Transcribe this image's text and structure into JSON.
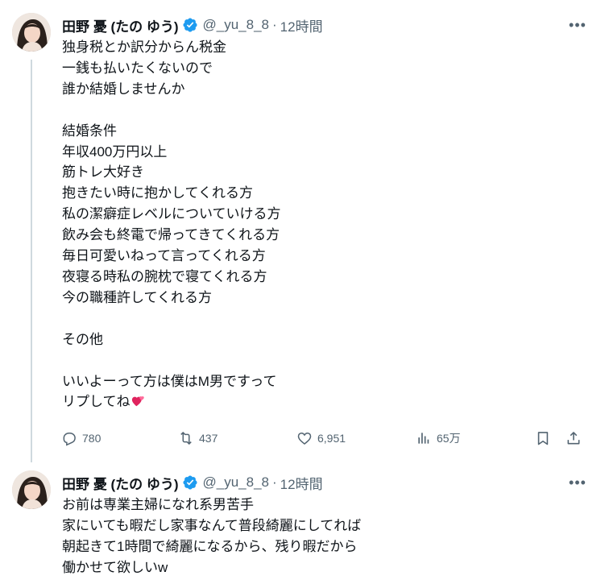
{
  "posts": [
    {
      "display_name": "田野 憂 (たの ゆう)",
      "handle": "@_yu_8_8",
      "separator": "·",
      "time": "12時間",
      "more_label": "•••",
      "text": "独身税とか訳分からん税金\n一銭も払いたくないので\n誰か結婚しませんか\n\n結婚条件\n年収400万円以上\n筋トレ大好き\n抱きたい時に抱かしてくれる方\n私の潔癖症レベルについていける方\n飲み会も終電で帰ってきてくれる方\n毎日可愛いねって言ってくれる方\n夜寝る時私の腕枕で寝てくれる方\n今の職種許してくれる方\n\nその他\n\nいいよーって方は僕はM男ですって\nリプしてね",
      "emoji_icon": "two-hearts",
      "stats": {
        "replies": "780",
        "reposts": "437",
        "likes": "6,951",
        "views": "65万"
      }
    },
    {
      "display_name": "田野 憂 (たの ゆう)",
      "handle": "@_yu_8_8",
      "separator": "·",
      "time": "12時間",
      "more_label": "•••",
      "text": "お前は専業主婦になれ系男苦手\n家にいても暇だし家事なんて普段綺麗にしてれば\n朝起きて1時間で綺麗になるから、残り暇だから\n働かせて欲しいw"
    }
  ],
  "colors": {
    "verified": "#1d9bf0",
    "secondary_text": "#536471",
    "thread_line": "#cfd9de",
    "heart": "#e0245e"
  }
}
